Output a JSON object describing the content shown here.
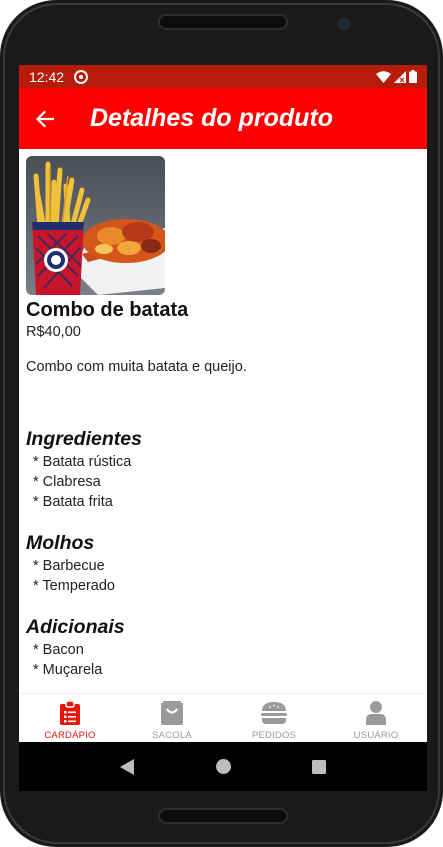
{
  "status_bar": {
    "time": "12:42"
  },
  "app_bar": {
    "title": "Detalhes do produto"
  },
  "product": {
    "name": "Combo de batata",
    "price": "R$40,00",
    "description": "Combo com muita batata e queijo."
  },
  "sections": {
    "ingredients": {
      "title": "Ingredientes",
      "items": [
        "Batata rústica",
        "Clabresa",
        "Batata frita"
      ]
    },
    "sauces": {
      "title": "Molhos",
      "items": [
        "Barbecue",
        "Temperado"
      ]
    },
    "addons": {
      "title": "Adicionais",
      "items": [
        "Bacon",
        "Muçarela"
      ]
    }
  },
  "bottom_nav": {
    "items": [
      {
        "label": "CARDÁPIO",
        "icon": "clipboard-list-icon",
        "active": true
      },
      {
        "label": "SACOLA",
        "icon": "shopping-bag-icon",
        "active": false
      },
      {
        "label": "PEDIDOS",
        "icon": "burger-icon",
        "active": false
      },
      {
        "label": "USUÁRIO",
        "icon": "user-icon",
        "active": false
      }
    ]
  },
  "colors": {
    "app_bar": "#ff0000",
    "status_bar": "#b51d0a",
    "nav_active": "#e8150c",
    "nav_inactive": "#9a9a9a"
  }
}
